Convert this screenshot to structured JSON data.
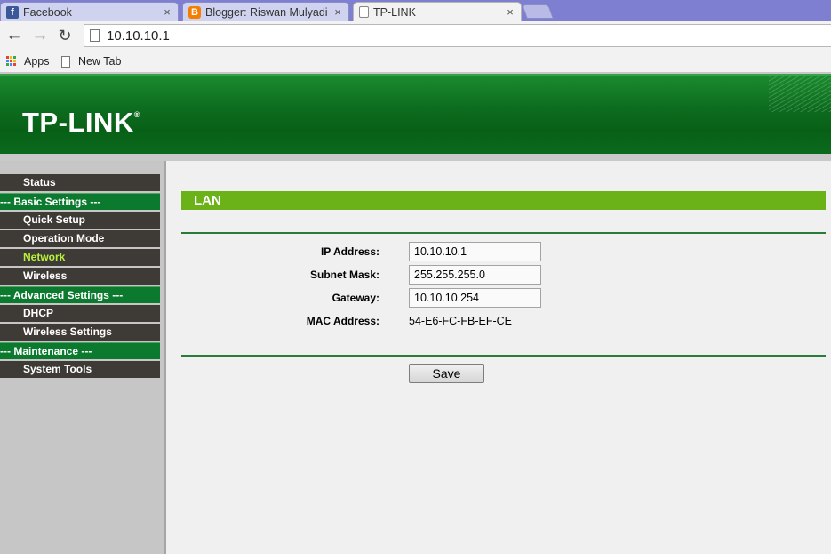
{
  "browser": {
    "tabs": [
      {
        "label": "Facebook",
        "icon": "facebook-icon",
        "color": "#3b5998",
        "glyph": "f"
      },
      {
        "label": "Blogger: Riswan Mulyadi -",
        "icon": "blogger-icon",
        "color": "#f57d00",
        "glyph": "B"
      },
      {
        "label": "TP-LINK",
        "icon": "page-icon"
      }
    ],
    "tab_close_glyph": "×",
    "url": "10.10.10.1",
    "bookmarks": [
      {
        "label": "Apps"
      },
      {
        "label": "New Tab"
      }
    ]
  },
  "router": {
    "logo": "TP-LINK",
    "logo_mark": "®",
    "menu": [
      {
        "label": "Status",
        "type": "item"
      },
      {
        "label": "--- Basic Settings ---",
        "type": "group"
      },
      {
        "label": "Quick Setup",
        "type": "item"
      },
      {
        "label": "Operation Mode",
        "type": "item"
      },
      {
        "label": "Network",
        "type": "item",
        "active": true
      },
      {
        "label": "Wireless",
        "type": "item"
      },
      {
        "label": "--- Advanced Settings ---",
        "type": "group"
      },
      {
        "label": "DHCP",
        "type": "item"
      },
      {
        "label": "Wireless Settings",
        "type": "item"
      },
      {
        "label": "--- Maintenance ---",
        "type": "group"
      },
      {
        "label": "System Tools",
        "type": "item"
      }
    ],
    "section_title": "LAN",
    "fields": {
      "ip_address": {
        "label": "IP Address:",
        "value": "10.10.10.1"
      },
      "subnet_mask": {
        "label": "Subnet Mask:",
        "value": "255.255.255.0"
      },
      "gateway": {
        "label": "Gateway:",
        "value": "10.10.10.254"
      },
      "mac_address": {
        "label": "MAC Address:",
        "value": "54-E6-FC-FB-EF-CE"
      }
    },
    "save_label": "Save",
    "colors": {
      "banner_green": "#086017",
      "section_green": "#6bb218",
      "menu_group_green": "#0c7a2e",
      "menu_item_dark": "#3e3b37",
      "menu_active_text": "#b7f23b"
    }
  }
}
